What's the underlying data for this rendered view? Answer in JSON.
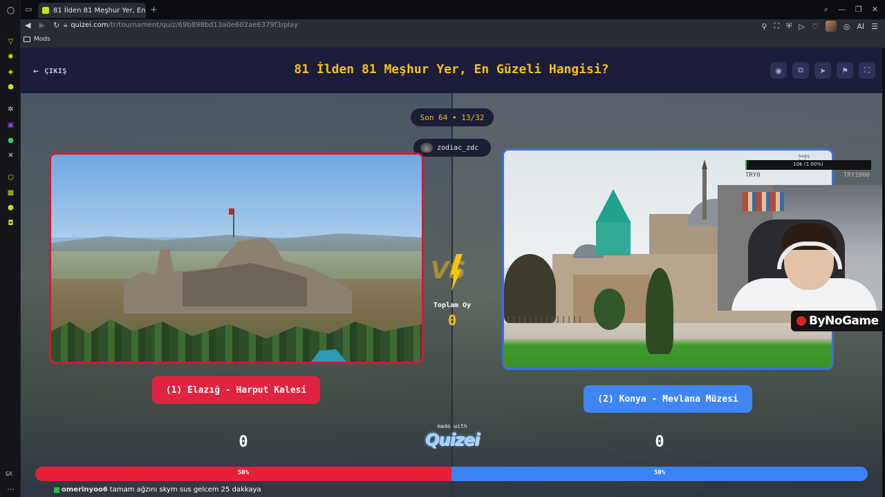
{
  "browser": {
    "tab_title": "81 İlden 81 Meşhur Yer, En",
    "tab_close": "×",
    "new_tab": "+",
    "url_host": "quizei.com",
    "url_path": "/tr/tournament/quiz/69b898bd13a0e602ae6379f3/play",
    "bookmark_folder": "Mods",
    "ai_label": "AI",
    "sidebar_label": "GX"
  },
  "header": {
    "exit_label": "ÇIKIŞ",
    "title": "81 İlden 81 Meşhur Yer, En Güzeli Hangisi?",
    "buttons": [
      "eye-icon",
      "share-icon",
      "send-icon",
      "flag-icon",
      "fullscreen-icon"
    ]
  },
  "round": {
    "label": "Son 64 • 13/32",
    "username": "zodiac_zdc"
  },
  "center": {
    "total_label": "Toplam Oy",
    "total_value": "0",
    "made_with": "made with",
    "logo": "Quizei"
  },
  "options": {
    "left": {
      "label": "(1) Elazığ - Harput Kalesi",
      "votes": "0",
      "percent_label": "50%",
      "share": 0.5,
      "color": "#e41f36"
    },
    "right": {
      "label": "(2) Konya - Mevlana Müzesi",
      "votes": "0",
      "percent_label": "50%",
      "share": 0.5,
      "color": "#3b82f6"
    }
  },
  "overlay": {
    "goal_title": "bağış barı",
    "goal_progress_text": "10₺ (1.00%)",
    "goal_fraction": 0.01,
    "goal_left": "TRY0",
    "goal_right": "TRY1000",
    "brand": "ByNoGame"
  },
  "chat": {
    "username": "omerinyoo6",
    "message": "tamam ağzını skym sus gelcem 25 dakkaya"
  }
}
